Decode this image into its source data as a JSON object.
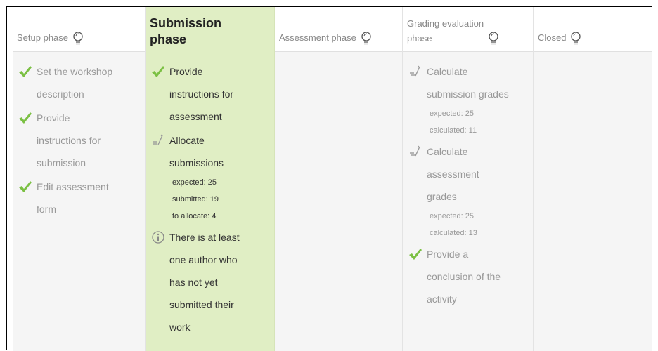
{
  "phases": [
    {
      "title_lines": [
        "Setup phase"
      ],
      "active": false,
      "tasks": [
        {
          "icon": "checkmark-icon",
          "lines": [
            "Set the workshop",
            "description"
          ],
          "details": []
        },
        {
          "icon": "checkmark-icon",
          "lines": [
            "Provide",
            "instructions for",
            "submission"
          ],
          "details": []
        },
        {
          "icon": "checkmark-icon",
          "lines": [
            "Edit assessment",
            "form"
          ],
          "details": []
        }
      ]
    },
    {
      "title_lines": [
        "Submission",
        "phase"
      ],
      "active": true,
      "tasks": [
        {
          "icon": "checkmark-icon",
          "lines": [
            "Provide",
            "instructions for",
            "assessment"
          ],
          "details": []
        },
        {
          "icon": "pending-icon",
          "lines": [
            "Allocate",
            "submissions"
          ],
          "details": [
            "expected: 25",
            "submitted: 19",
            "to allocate: 4"
          ]
        },
        {
          "icon": "info-icon",
          "lines": [
            "There is at least",
            "one author who",
            "has not yet",
            "submitted their",
            "work"
          ],
          "details": []
        }
      ]
    },
    {
      "title_lines": [
        "Assessment phase"
      ],
      "active": false,
      "tasks": []
    },
    {
      "title_lines": [
        "Grading evaluation",
        "phase"
      ],
      "active": false,
      "tasks": [
        {
          "icon": "pending-icon",
          "lines": [
            "Calculate",
            "submission grades"
          ],
          "details": [
            "expected: 25",
            "calculated: 11"
          ]
        },
        {
          "icon": "pending-icon",
          "lines": [
            "Calculate",
            "assessment",
            "grades"
          ],
          "details": [
            "expected: 25",
            "calculated: 13"
          ]
        },
        {
          "icon": "checkmark-icon",
          "lines": [
            "Provide a",
            "conclusion of the",
            "activity"
          ],
          "details": []
        }
      ]
    },
    {
      "title_lines": [
        "Closed"
      ],
      "active": false,
      "tasks": []
    }
  ],
  "colors": {
    "check": "#7bc043",
    "active_bg": "#e0eec4",
    "inactive_bg": "#f5f5f5"
  }
}
